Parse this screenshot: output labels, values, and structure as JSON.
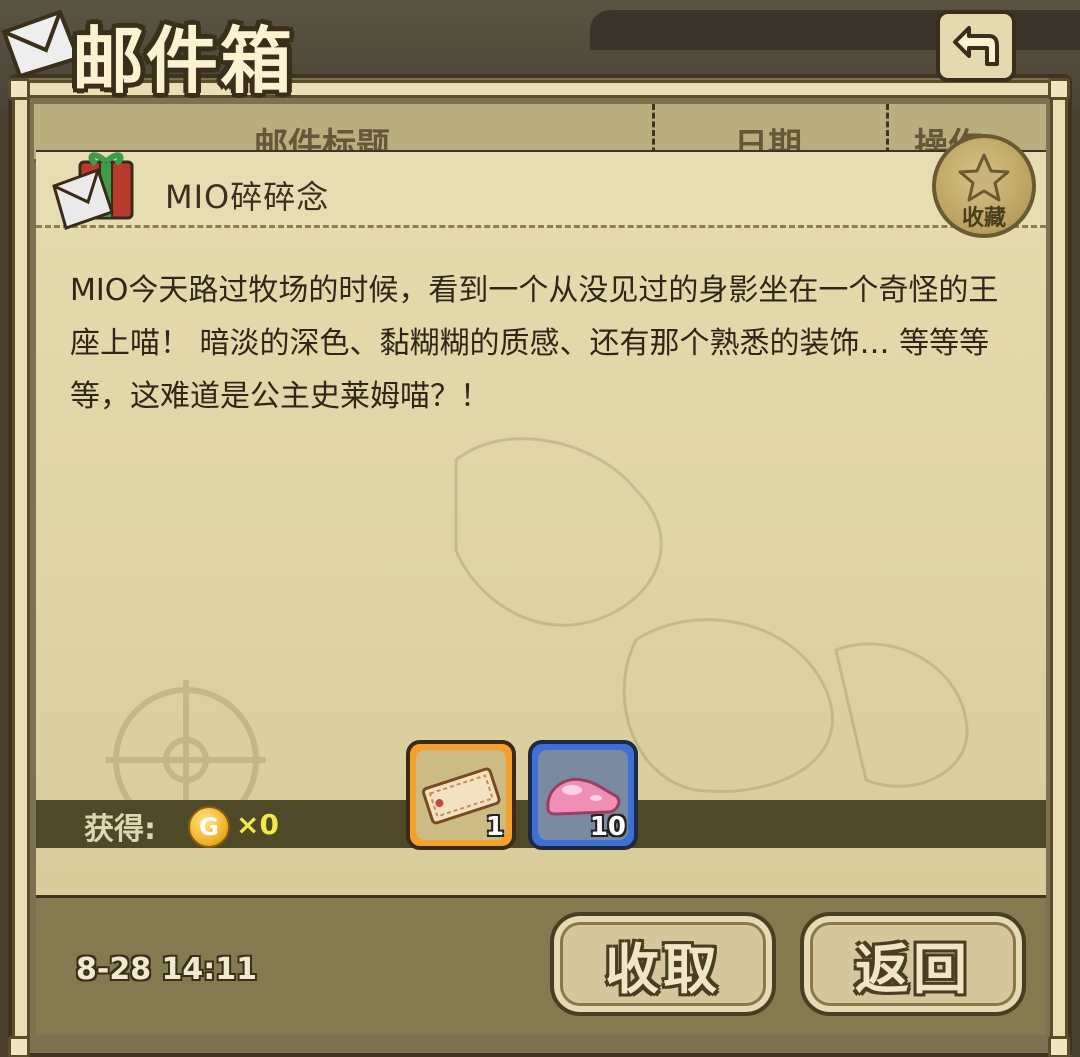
{
  "header": {
    "title": "邮件箱",
    "back_icon": "return-arrow-icon"
  },
  "table_header": {
    "columns": [
      "邮件标题",
      "日期",
      "操作"
    ]
  },
  "mail": {
    "title": "MIO碎碎念",
    "favorite_label": "收藏",
    "body": "MIO今天路过牧场的时候，看到一个从没见过的身影坐在一个奇怪的王座上喵！ 暗淡的深色、黏糊糊的质感、还有那个熟悉的装饰… 等等等等，这难道是公主史莱姆喵？！",
    "date": "8-28 14:11"
  },
  "rewards": {
    "label": "获得:",
    "coin_symbol": "G",
    "coin_count": "×0",
    "items": [
      {
        "icon": "ticket-icon",
        "count": "1",
        "frame_color": "#f4a12c"
      },
      {
        "icon": "pink-slime-icon",
        "count": "10",
        "frame_color": "#3e6fd4"
      }
    ]
  },
  "buttons": {
    "collect": "收取",
    "back": "返回"
  }
}
